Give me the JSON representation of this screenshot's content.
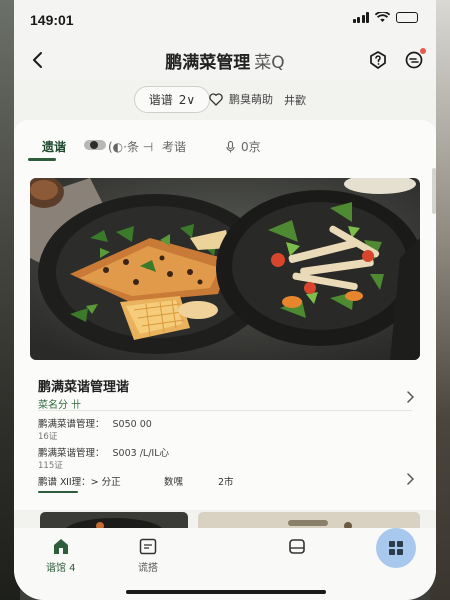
{
  "status_bar": {
    "time": "149:01"
  },
  "header": {
    "title": "鹏满菜管理",
    "title_suffix": "菜Q"
  },
  "filter_chips": {
    "pill_label": "谐谱",
    "pill_count": "2∨",
    "fav_label": "鹏臭萌助",
    "extra_label": "井歡"
  },
  "tabs": [
    {
      "label": "遗谐"
    },
    {
      "label": "(◐⋅条 ⊣"
    },
    {
      "label": "考谐"
    },
    {
      "label": "0京"
    }
  ],
  "recipe": {
    "title": "鹏满菜谐管理谐",
    "subtitle": "菜名分 卄",
    "rows": [
      {
        "label": "鹏满菜谱管理：",
        "value": "S050 00",
        "meta": "16证"
      },
      {
        "label": "鹏满菜谐管理：",
        "value": "S003 /L/IL心",
        "meta": "115证"
      }
    ],
    "bottom": {
      "a": "鹏谱 ⅪI理：> 分正",
      "b": "数嘿",
      "c": "2市"
    }
  },
  "tabbar": {
    "items": [
      {
        "label": "谐馆 4",
        "icon": "home-icon"
      },
      {
        "label": "谎搭",
        "icon": "calendar-icon"
      },
      {
        "label": "",
        "icon": "box-icon"
      }
    ],
    "fab_icon": "grid-icon"
  },
  "colors": {
    "accent": "#2e5d3c",
    "badge": "#e65a4f",
    "fab": "#a9c8ee"
  }
}
